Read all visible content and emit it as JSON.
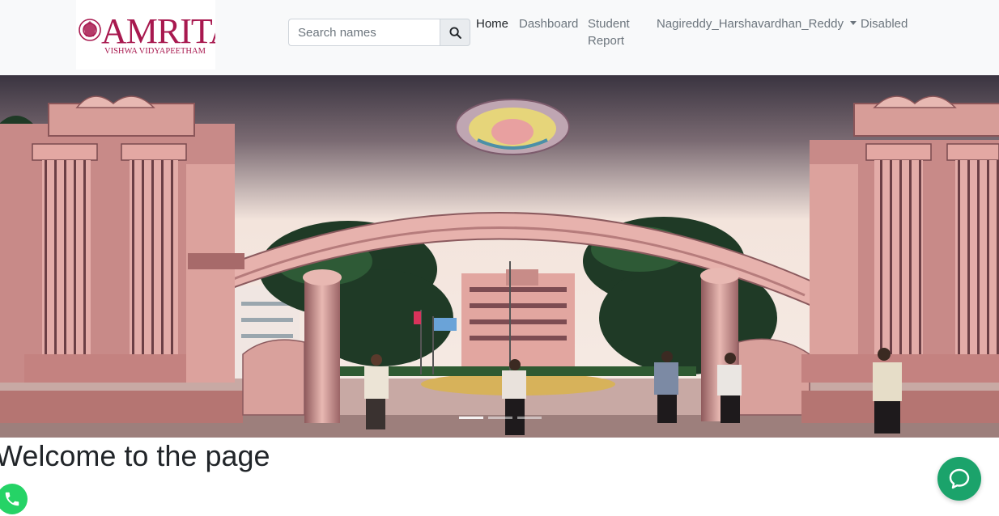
{
  "brand": {
    "name": "AMRITA",
    "subtitle": "VISHWA VIDYAPEETHAM",
    "color": "#a8194f"
  },
  "search": {
    "placeholder": "Search names",
    "value": "",
    "button_icon": "search-icon"
  },
  "nav": {
    "home": "Home",
    "dashboard": "Dashboard",
    "student_report": "Student Report",
    "user": "Nagireddy_Harshavardhan_Reddy",
    "disabled": "Disabled"
  },
  "main": {
    "heading": "Welcome to the page"
  },
  "widgets": {
    "whatsapp_icon": "whatsapp-icon",
    "chat_icon": "chat-bubble-icon",
    "whatsapp_color": "#25d366",
    "chat_color": "#1ba36b"
  }
}
